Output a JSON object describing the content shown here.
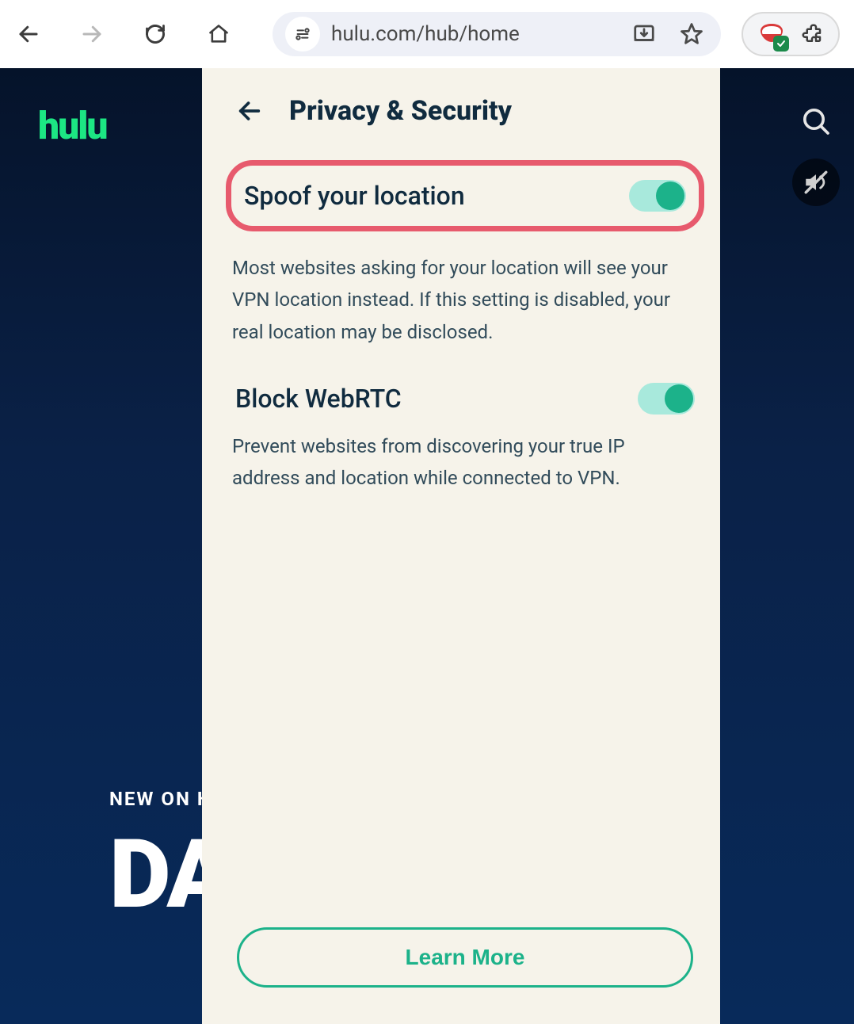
{
  "browser": {
    "url": "hulu.com/hub/home"
  },
  "page": {
    "brand": "hulu",
    "hero_label": "NEW ON H",
    "hero_title": "DA"
  },
  "popup": {
    "title": "Privacy & Security",
    "settings": {
      "spoof": {
        "label": "Spoof your location",
        "description": "Most websites asking for your location will see your VPN location instead. If this setting is disabled, your real location may be disclosed.",
        "enabled": true
      },
      "webrtc": {
        "label": "Block WebRTC",
        "description": "Prevent websites from discovering your true IP address and location while connected to VPN.",
        "enabled": true
      }
    },
    "cta": "Learn More"
  }
}
